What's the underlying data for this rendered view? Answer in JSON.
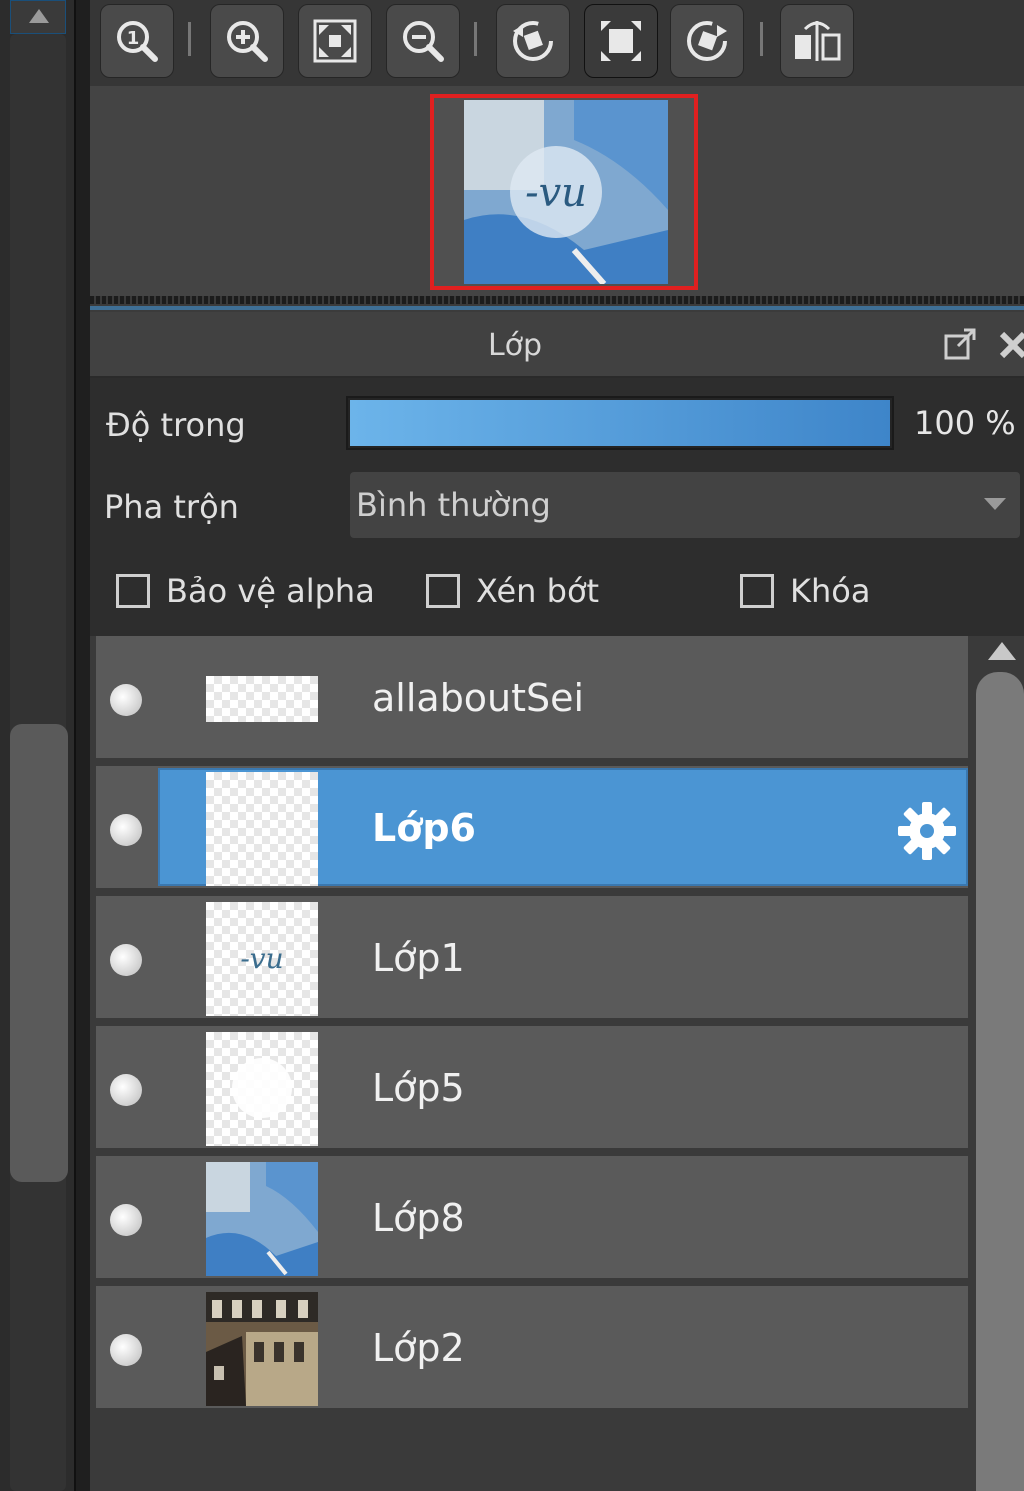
{
  "toolbar": {
    "buttons": [
      {
        "name": "zoom-actual-icon"
      },
      {
        "name": "zoom-in-icon"
      },
      {
        "name": "fit-window-icon"
      },
      {
        "name": "zoom-out-icon"
      },
      {
        "name": "rotate-left-icon"
      },
      {
        "name": "fullscreen-icon"
      },
      {
        "name": "rotate-right-icon"
      },
      {
        "name": "flip-icon"
      }
    ]
  },
  "layer_panel": {
    "title": "Lớp",
    "opacity_label": "Độ trong",
    "opacity_value": "100 %",
    "opacity_fraction": 1.0,
    "blend_label": "Pha trộn",
    "blend_value": "Bình thường",
    "protect_alpha_label": "Bảo vệ alpha",
    "clipping_label": "Xén bớt",
    "lock_label": "Khóa"
  },
  "layers": [
    {
      "name": "allaboutSei",
      "selected": false,
      "thumb": "text"
    },
    {
      "name": "Lớp6",
      "selected": true,
      "thumb": "empty"
    },
    {
      "name": "Lớp1",
      "selected": false,
      "thumb": "script"
    },
    {
      "name": "Lớp5",
      "selected": false,
      "thumb": "white"
    },
    {
      "name": "Lớp8",
      "selected": false,
      "thumb": "photo-blue"
    },
    {
      "name": "Lớp2",
      "selected": false,
      "thumb": "photo-building"
    }
  ],
  "colors": {
    "accent": "#4b95d3",
    "navigator_border": "#e02020"
  }
}
